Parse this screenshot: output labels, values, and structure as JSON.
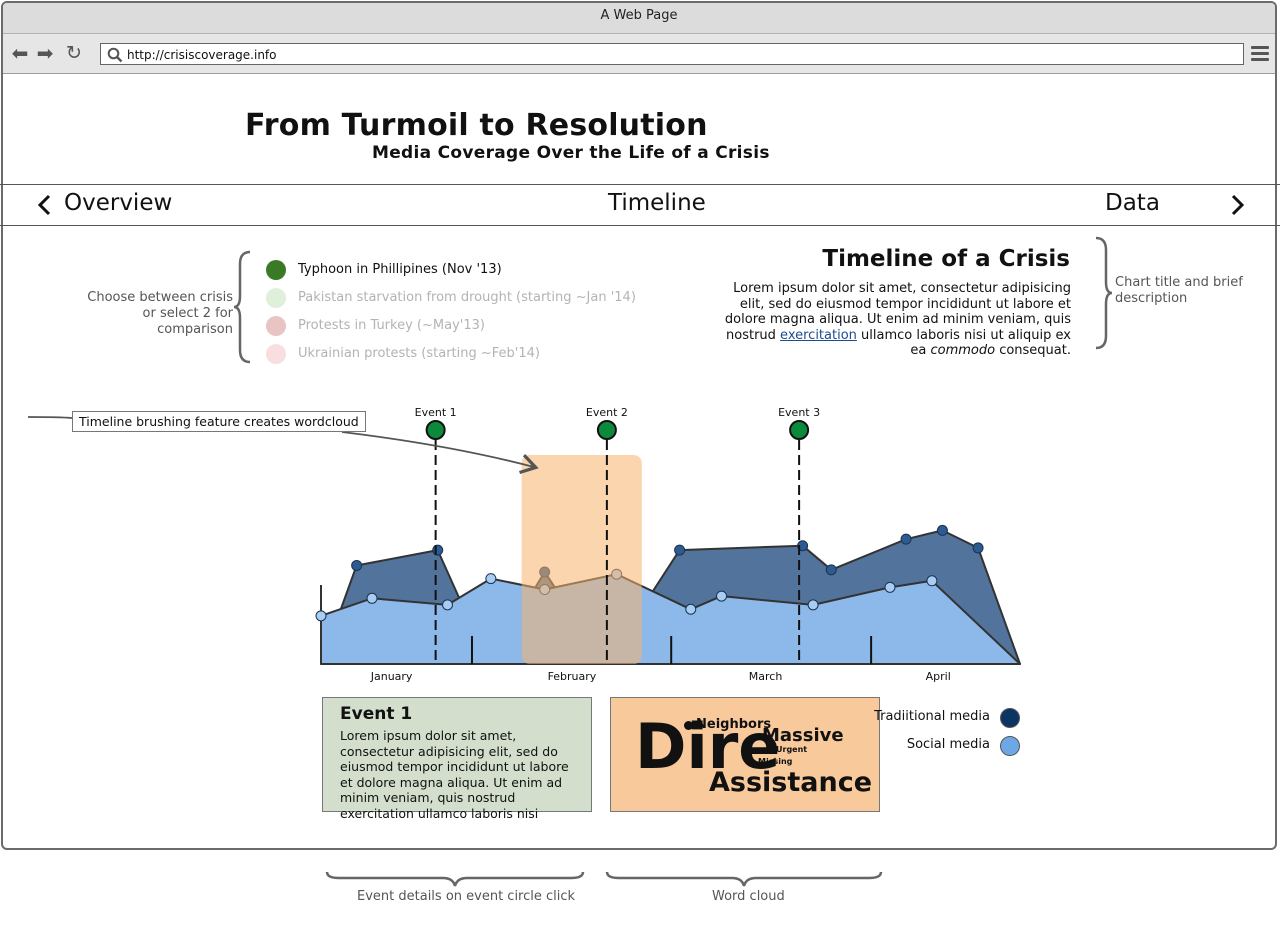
{
  "browser": {
    "window_title": "A Web Page",
    "url": "http://crisiscoverage.info"
  },
  "header": {
    "title": "From Turmoil to Resolution",
    "subtitle": "Media Coverage Over the Life of a Crisis"
  },
  "nav": {
    "prev_label": "Overview",
    "current_label": "Timeline",
    "next_label": "Data"
  },
  "crisis_selector": {
    "note": "Choose between crisis or select 2 for comparison",
    "items": [
      {
        "label": "Typhoon in Phillipines (Nov '13)",
        "color": "#3a7a27",
        "text_color": "#111111"
      },
      {
        "label": "Pakistan starvation from drought (starting ~Jan '14)",
        "color": "#e0efd9",
        "text_color": "#b3b3b3"
      },
      {
        "label": "Protests in Turkey (~May'13)",
        "color": "#e8c4c4",
        "text_color": "#b3b3b3"
      },
      {
        "label": "Ukrainian protests (starting ~Feb'14)",
        "color": "#f8dede",
        "text_color": "#b3b3b3"
      }
    ]
  },
  "chart_info": {
    "title": "Timeline of a Crisis",
    "desc_before_link": "Lorem ipsum dolor sit amet, consectetur adipisicing elit, sed do eiusmod tempor incididunt ut labore et dolore magna aliqua. Ut enim ad minim veniam, quis nostrud ",
    "desc_link": "exercitation",
    "desc_middle": " ullamco laboris nisi ut aliquip ex ea ",
    "desc_italic": "commodo",
    "desc_end": " consequat.",
    "side_note": "Chart title and brief description"
  },
  "brush_note": "Timeline brushing feature creates wordcloud",
  "chart_data": {
    "type": "area",
    "x_range": [
      0,
      100
    ],
    "y_range": [
      0,
      100
    ],
    "series": [
      {
        "name": "Tradiitional media",
        "color": "#0d3563",
        "fill": "#52739b",
        "points": [
          [
            0,
            0
          ],
          [
            5.1,
            45
          ],
          [
            16.7,
            52
          ],
          [
            24.0,
            0
          ],
          [
            32.0,
            42
          ],
          [
            40.7,
            0
          ],
          [
            51.3,
            52
          ],
          [
            68.9,
            54
          ],
          [
            73.0,
            43
          ],
          [
            83.7,
            57
          ],
          [
            88.9,
            61
          ],
          [
            94.0,
            53
          ],
          [
            100,
            0
          ]
        ]
      },
      {
        "name": "Social media",
        "color": "#6da7e6",
        "fill": "#8cb8ea",
        "points": [
          [
            0,
            22
          ],
          [
            7.3,
            30
          ],
          [
            18.1,
            27
          ],
          [
            24.3,
            39
          ],
          [
            32.0,
            34
          ],
          [
            42.3,
            41
          ],
          [
            52.9,
            25
          ],
          [
            57.3,
            31
          ],
          [
            70.4,
            27
          ],
          [
            81.4,
            35
          ],
          [
            87.4,
            38
          ],
          [
            100,
            0
          ]
        ]
      }
    ],
    "brush": {
      "x0": 28.7,
      "x1": 45.9
    },
    "events": [
      {
        "label": "Event 1",
        "x": 16.4
      },
      {
        "label": "Event 2",
        "x": 40.9
      },
      {
        "label": "Event 3",
        "x": 68.4
      }
    ],
    "month_ticks": [
      21.6,
      50.1,
      78.7
    ],
    "x_labels": [
      {
        "label": "January",
        "x": 10.1
      },
      {
        "label": "February",
        "x": 35.9
      },
      {
        "label": "March",
        "x": 63.6
      },
      {
        "label": "April",
        "x": 88.3
      }
    ]
  },
  "event_card": {
    "title": "Event 1",
    "body": "Lorem ipsum dolor sit amet, consectetur adipisicing elit, sed do eiusmod tempor incididunt ut labore et dolore magna aliqua. Ut enim ad minim veniam, quis nostrud exercitation ullamco laboris nisi",
    "color": "#d3dfcc"
  },
  "wordcloud": {
    "words": [
      "Dire",
      "Neighbors",
      "Massive",
      "Help",
      "Urgent",
      "Missing",
      "Assistance"
    ],
    "color": "#f8c99a"
  },
  "legend": {
    "items": [
      {
        "label": "Tradiitional media",
        "color": "#0d3563"
      },
      {
        "label": "Social media",
        "color": "#6da7e6"
      }
    ]
  },
  "annotations": {
    "event_details": "Event details on event circle click",
    "word_cloud": "Word cloud"
  }
}
